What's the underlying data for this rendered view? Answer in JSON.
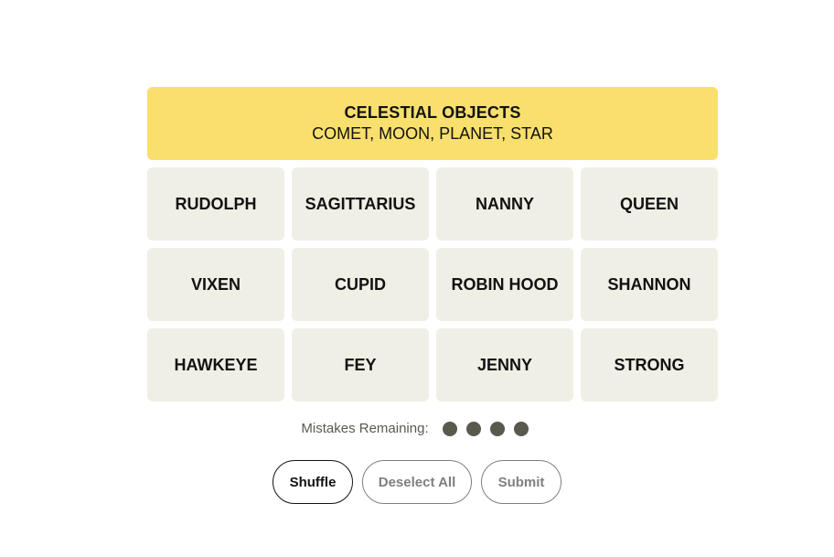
{
  "solved_groups": [
    {
      "title": "CELESTIAL OBJECTS",
      "members": "COMET, MOON, PLANET, STAR",
      "color": "#f9df6d"
    }
  ],
  "tiles": [
    "RUDOLPH",
    "SAGITTARIUS",
    "NANNY",
    "QUEEN",
    "VIXEN",
    "CUPID",
    "ROBIN HOOD",
    "SHANNON",
    "HAWKEYE",
    "FEY",
    "JENNY",
    "STRONG"
  ],
  "mistakes": {
    "label": "Mistakes Remaining:",
    "remaining": 4
  },
  "controls": {
    "shuffle": "Shuffle",
    "deselect_all": "Deselect All",
    "submit": "Submit"
  }
}
